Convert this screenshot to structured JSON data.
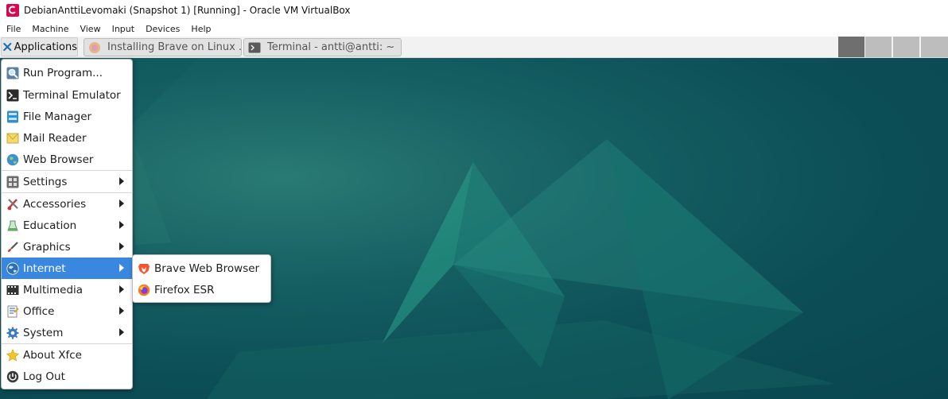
{
  "window": {
    "title": "DebianAnttiLevomaki (Snapshot 1) [Running] - Oracle VM VirtualBox",
    "icon": "debian-swirl-icon"
  },
  "menubar": [
    "File",
    "Machine",
    "View",
    "Input",
    "Devices",
    "Help"
  ],
  "panel": {
    "applications_label": "Applications",
    "tasks": [
      {
        "label": "Installing Brave on Linux ...",
        "icon": "firefox-icon"
      },
      {
        "label": "Terminal - antti@antti: ~",
        "icon": "terminal-icon"
      }
    ],
    "workspaces": {
      "count": 4,
      "active_index": 0
    }
  },
  "app_menu": {
    "items": [
      {
        "label": "Run Program...",
        "icon": "search-icon"
      },
      {
        "label": "Terminal Emulator",
        "icon": "terminal-icon"
      },
      {
        "label": "File Manager",
        "icon": "file-manager-icon"
      },
      {
        "label": "Mail Reader",
        "icon": "mail-icon"
      },
      {
        "label": "Web Browser",
        "icon": "globe-icon"
      },
      {
        "label": "Settings",
        "icon": "settings-icon",
        "submenu": true
      },
      {
        "label": "Accessories",
        "icon": "accessories-icon",
        "submenu": true
      },
      {
        "label": "Education",
        "icon": "education-icon",
        "submenu": true
      },
      {
        "label": "Graphics",
        "icon": "graphics-icon",
        "submenu": true
      },
      {
        "label": "Internet",
        "icon": "internet-icon",
        "submenu": true,
        "highlighted": true
      },
      {
        "label": "Multimedia",
        "icon": "multimedia-icon",
        "submenu": true
      },
      {
        "label": "Office",
        "icon": "office-icon",
        "submenu": true
      },
      {
        "label": "System",
        "icon": "system-gear-icon",
        "submenu": true
      },
      {
        "label": "About Xfce",
        "icon": "star-icon"
      },
      {
        "label": "Log Out",
        "icon": "logout-icon"
      }
    ]
  },
  "internet_submenu": {
    "items": [
      {
        "label": "Brave Web Browser",
        "icon": "brave-lion-icon"
      },
      {
        "label": "Firefox ESR",
        "icon": "firefox-icon"
      }
    ]
  },
  "colors": {
    "highlight": "#3a87e0",
    "desktop": "#0c4e56",
    "panel": "#f2f2f2",
    "active_workspace": "#6f6f6f"
  }
}
